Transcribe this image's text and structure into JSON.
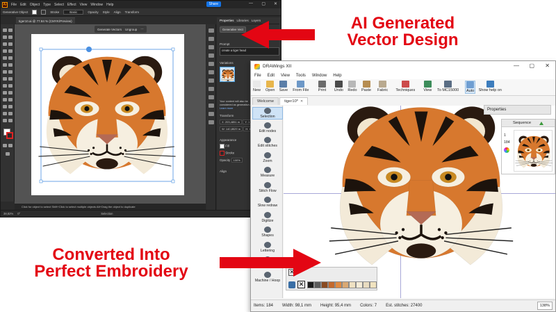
{
  "illustrator": {
    "logo": "Ai",
    "menu": [
      "File",
      "Edit",
      "Object",
      "Type",
      "Select",
      "Effect",
      "View",
      "Window",
      "Help"
    ],
    "share_label": "Share",
    "window_controls": [
      "—",
      "▢",
      "✕"
    ],
    "control_bar": {
      "selection": "Generative Object",
      "stroke_label": "Stroke",
      "basic_label": "Basic",
      "opacity_label": "Opacity",
      "opacity_value": "Style",
      "align_label": "Align",
      "transform_label": "Transform"
    },
    "doc_tab": "tiger10.ai @ 77.84 % (CMYK/Preview)",
    "context_bar": {
      "generate_vectors": "Generate Vectors",
      "ungroup": "Ungroup"
    },
    "hint_text": "Click for object to select   Shift+Click to select multiple objects   Alt+Drag the object to duplicate",
    "status": {
      "zoom": "38,82%",
      "angle": "0°",
      "selection": "Selection"
    },
    "properties": {
      "tabs": [
        "Properties",
        "Libraries",
        "Layers"
      ],
      "generative_label": "Generative Vect",
      "prompt_label": "Prompt",
      "prompt_value": "create a tiger head",
      "variations_label": "Variations",
      "notice_text": "Your content will also be considered as generative AI...",
      "learn_more": "Learn more",
      "transform_label": "Transform",
      "x_value": "X: 203,4851 m",
      "y_value": "Y: 1",
      "w_value": "W: 140,8529 m",
      "h_value": "H: 1",
      "appearance_label": "Appearance",
      "fill_label": "Fill",
      "stroke_label": "Stroke",
      "opacity_label": "Opacity",
      "opacity_value": "100%",
      "align_label": "Align"
    }
  },
  "drawings": {
    "title": "DRAWings XII",
    "window_controls": [
      "—",
      "▢",
      "✕"
    ],
    "menu": [
      "File",
      "Edit",
      "View",
      "Tools",
      "Window",
      "Help"
    ],
    "toolbar": [
      {
        "label": "New",
        "color": "#e9e9e9"
      },
      {
        "label": "Open",
        "color": "#e8b64c"
      },
      {
        "label": "Save",
        "color": "#5c7fa8"
      },
      {
        "label": "From File",
        "color": "#6d98c7"
      },
      {
        "label": "Print",
        "color": "#6c6c6c"
      },
      {
        "label": "Undo",
        "color": "#4b4b4b"
      },
      {
        "label": "Redo",
        "color": "#b8b8b8"
      },
      {
        "label": "Paste",
        "color": "#b68d52"
      },
      {
        "label": "Fabric",
        "color": "#b9a98f"
      },
      {
        "label": "Techniques",
        "color": "#cc4b4b"
      },
      {
        "label": "View",
        "color": "#3c8c5a"
      },
      {
        "label": "To MC15000",
        "color": "#5a6d84"
      },
      {
        "label": "Auto",
        "color": "#6f9ed2"
      },
      {
        "label": "Show help on",
        "color": "#3d7dbd"
      }
    ],
    "tabs": [
      {
        "label": "Welcome",
        "active": false
      },
      {
        "label": "tiger10*",
        "active": true
      }
    ],
    "tab_close": "✕",
    "left_tools": [
      {
        "label": "Selection",
        "active": true
      },
      {
        "label": "Edit nodes",
        "active": false
      },
      {
        "label": "Edit stitches",
        "active": false
      },
      {
        "label": "Zoom",
        "active": false
      },
      {
        "label": "Measure",
        "active": false
      },
      {
        "label": "Stitch Flow",
        "active": false
      },
      {
        "label": "Slow redraw",
        "active": false
      },
      {
        "label": "Digitize",
        "active": false
      },
      {
        "label": "Shapes",
        "active": false
      },
      {
        "label": "Lettering",
        "active": false
      },
      {
        "label": "Color manager",
        "active": false
      },
      {
        "label": "Machine / Hoop",
        "active": false
      }
    ],
    "properties_label": "Properties",
    "sequence": {
      "label": "Sequence",
      "count_a": "1",
      "count_b": "184"
    },
    "thread_colors": [
      "#1b1b1b",
      "#5b5b5b",
      "#8a4b22",
      "#c4692d",
      "#e08a42",
      "#d9a874",
      "#efe1c2",
      "#f5ecd7",
      "#e8dbc0",
      "#f1e3bf"
    ],
    "status": {
      "items": "Items: 184",
      "width": "Width: 98,1 mm",
      "height": "Height: 95,4 mm",
      "colors": "Colors: 7",
      "stitches": "Est. stitches: 27400",
      "zoom": "138%"
    }
  },
  "annotations": {
    "top_line1": "AI Generated",
    "top_line2": "Vector Design",
    "bottom_line1": "Converted Into",
    "bottom_line2": "Perfect Embroidery",
    "color": "#e30613"
  }
}
